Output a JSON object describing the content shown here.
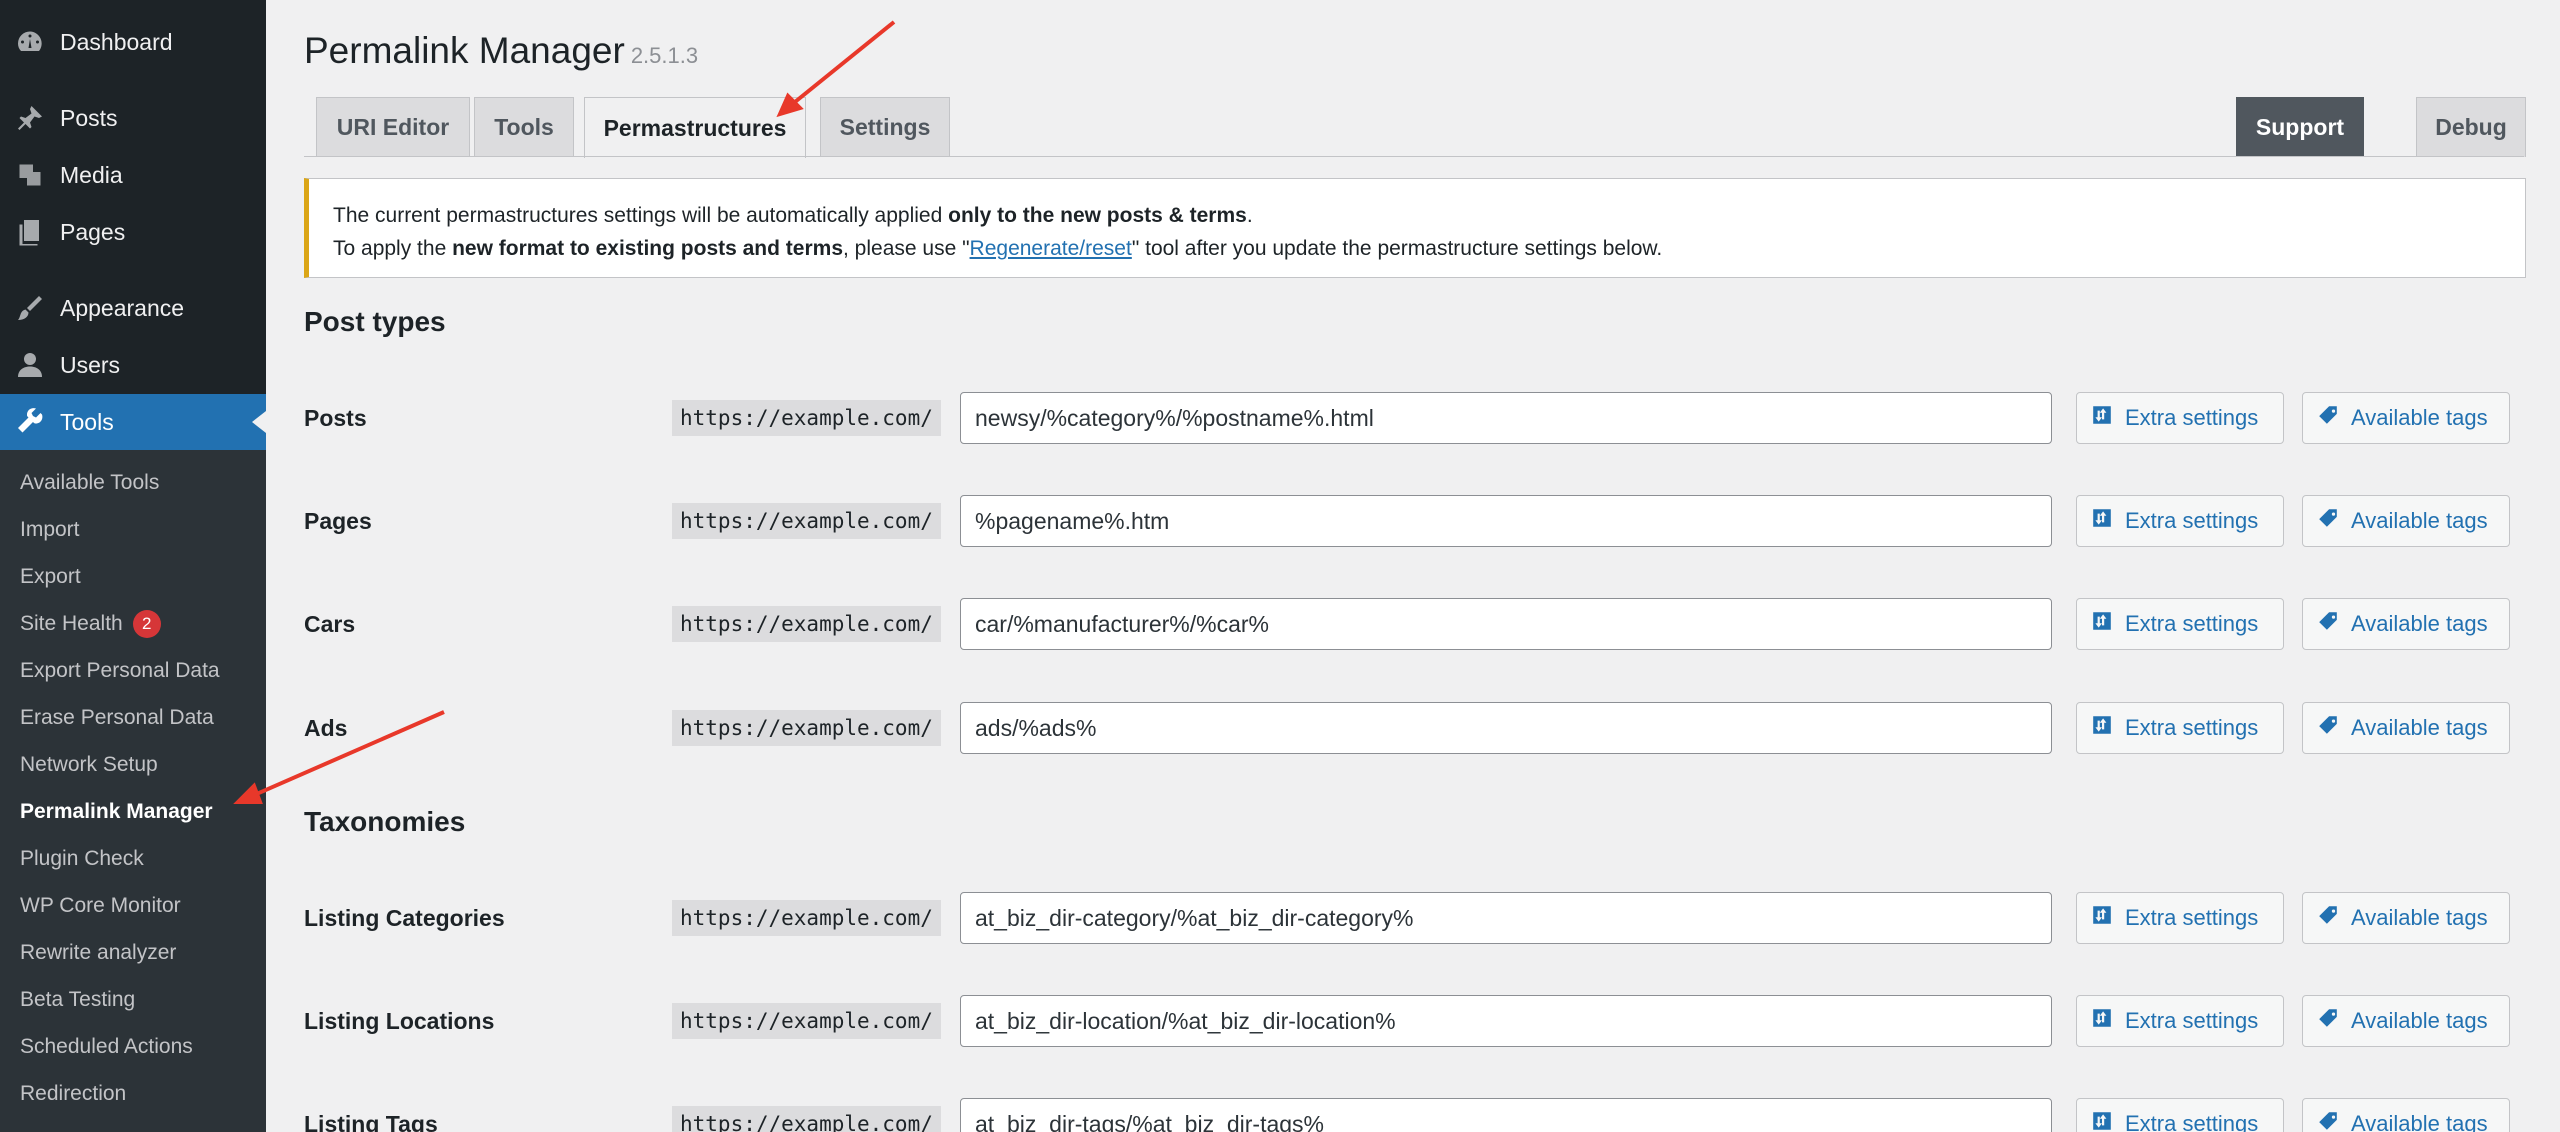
{
  "sidebar": {
    "menu": [
      {
        "label": "Dashboard",
        "icon": "dashboard-icon"
      },
      {
        "label": "Posts",
        "icon": "pin-icon"
      },
      {
        "label": "Media",
        "icon": "media-icon"
      },
      {
        "label": "Pages",
        "icon": "pages-icon"
      },
      {
        "label": "Appearance",
        "icon": "brush-icon"
      },
      {
        "label": "Users",
        "icon": "user-icon"
      },
      {
        "label": "Tools",
        "icon": "wrench-icon"
      }
    ],
    "submenu": [
      {
        "label": "Available Tools"
      },
      {
        "label": "Import"
      },
      {
        "label": "Export"
      },
      {
        "label": "Site Health",
        "badge": "2"
      },
      {
        "label": "Export Personal Data"
      },
      {
        "label": "Erase Personal Data"
      },
      {
        "label": "Network Setup"
      },
      {
        "label": "Permalink Manager"
      },
      {
        "label": "Plugin Check"
      },
      {
        "label": "WP Core Monitor"
      },
      {
        "label": "Rewrite analyzer"
      },
      {
        "label": "Beta Testing"
      },
      {
        "label": "Scheduled Actions"
      },
      {
        "label": "Redirection"
      }
    ]
  },
  "header": {
    "title": "Permalink Manager",
    "version": "2.5.1.3"
  },
  "tabs": [
    {
      "label": "URI Editor"
    },
    {
      "label": "Tools"
    },
    {
      "label": "Permastructures"
    },
    {
      "label": "Settings"
    }
  ],
  "right_tabs": [
    {
      "label": "Support"
    },
    {
      "label": "Debug"
    }
  ],
  "notice": {
    "line1_a": "The current permastructures settings will be automatically applied ",
    "line1_b": "only to the new posts & terms",
    "line1_c": ".",
    "line2_a": "To apply the ",
    "line2_b": "new format to existing posts and terms",
    "line2_c": ", please use \"",
    "line2_link": "Regenerate/reset",
    "line2_d": "\" tool after you update the permastructure settings below."
  },
  "sections": {
    "post_types": "Post types",
    "taxonomies": "Taxonomies"
  },
  "prefix": "https://example.com/",
  "buttons": {
    "extra": "Extra settings",
    "tags": "Available tags"
  },
  "post_types": [
    {
      "label": "Posts",
      "value": "newsy/%category%/%postname%.html"
    },
    {
      "label": "Pages",
      "value": "%pagename%.htm"
    },
    {
      "label": "Cars",
      "value": "car/%manufacturer%/%car%"
    },
    {
      "label": "Ads",
      "value": "ads/%ads%"
    }
  ],
  "taxonomies": [
    {
      "label": "Listing Categories",
      "value": "at_biz_dir-category/%at_biz_dir-category%"
    },
    {
      "label": "Listing Locations",
      "value": "at_biz_dir-location/%at_biz_dir-location%"
    },
    {
      "label": "Listing Tags",
      "value": "at_biz_dir-tags/%at_biz_dir-tags%"
    }
  ],
  "colors": {
    "sidebar_bg": "#1d2327",
    "submenu_bg": "#2c3338",
    "accent": "#2271b1",
    "notice_border": "#dba617",
    "badge": "#d63638",
    "annotation_arrow": "#e8382a"
  }
}
